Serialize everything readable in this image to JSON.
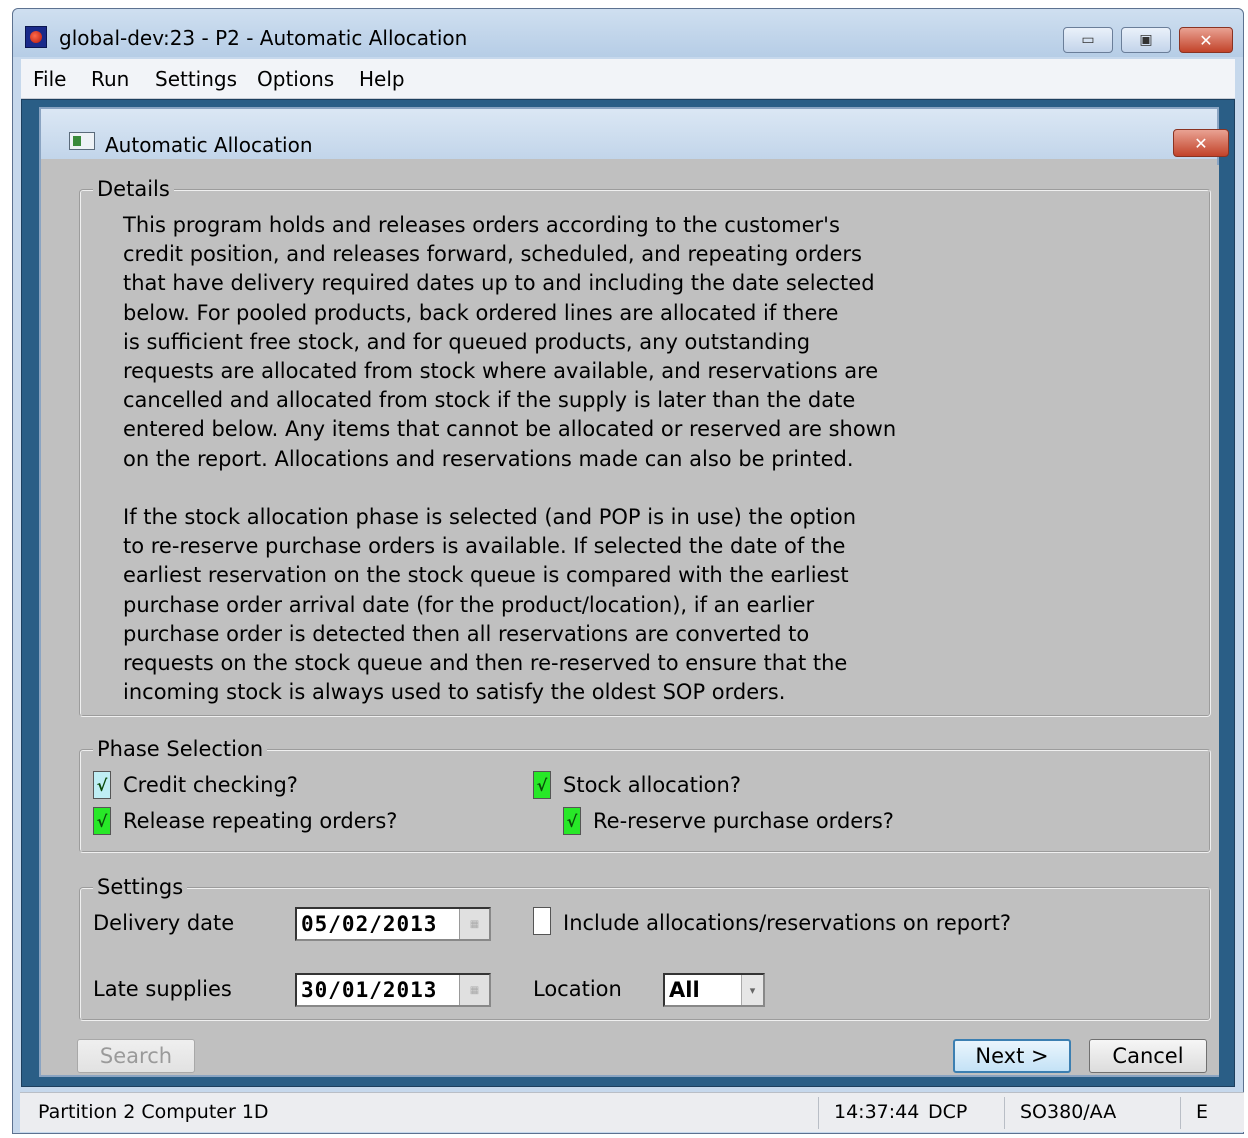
{
  "window": {
    "title": "global-dev:23 - P2 - Automatic Allocation",
    "minimize_glyph": "▭",
    "maximize_glyph": "▣",
    "close_glyph": "✕"
  },
  "menu": [
    "File",
    "Run",
    "Settings",
    "Options",
    "Help"
  ],
  "dialog": {
    "title": "Automatic Allocation",
    "close_glyph": "✕"
  },
  "details": {
    "legend": "Details",
    "text": "This program holds and releases orders according to the customer's\ncredit position, and releases forward, scheduled, and repeating orders\nthat have delivery required dates up to and including the date selected\nbelow. For pooled products, back ordered lines are allocated if there\nis sufficient free stock, and for queued products, any outstanding\nrequests are allocated from stock where available, and reservations are\ncancelled and allocated from stock if the supply is later than the date\nentered below. Any items that cannot be allocated or reserved are shown\non the report. Allocations and reservations made can also be printed.\n\nIf the stock allocation phase is selected (and POP is in use) the option\nto re-reserve purchase orders is available. If selected the date of the\nearliest reservation on the stock queue is compared with the earliest\npurchase order arrival date (for the product/location), if an earlier\npurchase order is detected then all reservations are converted to\nrequests on the stock queue and then re-reserved to ensure that the\nincoming stock is always used to satisfy the oldest SOP orders."
  },
  "phase": {
    "legend": "Phase Selection",
    "credit_checking": {
      "label": "Credit checking?",
      "checked": true,
      "mark": "√"
    },
    "release_repeating": {
      "label": "Release repeating orders?",
      "checked": true,
      "mark": "√"
    },
    "stock_allocation": {
      "label": "Stock allocation?",
      "checked": true,
      "mark": "√"
    },
    "re_reserve": {
      "label": "Re-reserve purchase orders?",
      "checked": true,
      "mark": "√"
    }
  },
  "settings": {
    "legend": "Settings",
    "delivery_date_label": "Delivery date",
    "delivery_date_value": "05/02/2013",
    "late_supplies_label": "Late supplies",
    "late_supplies_value": "30/01/2013",
    "include_label": "Include allocations/reservations on report?",
    "include_checked": false,
    "location_label": "Location",
    "location_value": "All",
    "location_arrow": "▾",
    "calendar_glyph": "▦"
  },
  "buttons": {
    "search": "Search",
    "next": "Next >",
    "cancel": "Cancel"
  },
  "statusbar": {
    "partition": "Partition 2 Computer 1D",
    "time": "14:37:44",
    "user": "DCP",
    "program": "SO380/AA",
    "mode": "E"
  },
  "colors": {
    "mdi_background": "#2a5e86",
    "dialog_background": "#c0c0c0",
    "checked": "#28e828"
  }
}
